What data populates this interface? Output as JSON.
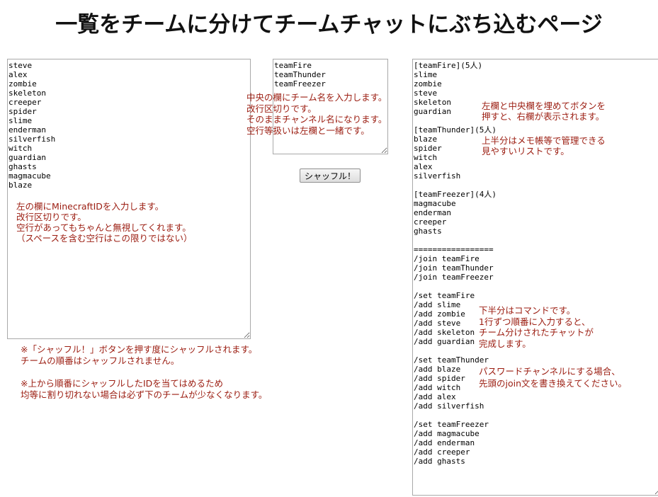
{
  "page": {
    "title": "一覧をチームに分けてチームチャットにぶち込むページ"
  },
  "left_textarea": {
    "value": "steve\nalex\nzombie\nskeleton\ncreeper\nspider\nslime\nenderman\nsilverfish\nwitch\nguardian\nghasts\nmagmacube\nblaze"
  },
  "middle_textarea": {
    "value": "teamFire\nteamThunder\nteamFreezer"
  },
  "right_textarea": {
    "value": "[teamFire](5人)\nslime\nzombie\nsteve\nskeleton\nguardian\n\n[teamThunder](5人)\nblaze\nspider\nwitch\nalex\nsilverfish\n\n[teamFreezer](4人)\nmagmacube\nenderman\ncreeper\nghasts\n\n=================\n/join teamFire\n/join teamThunder\n/join teamFreezer\n\n/set teamFire\n/add slime\n/add zombie\n/add steve\n/add skeleton\n/add guardian\n\n/set teamThunder\n/add blaze\n/add spider\n/add witch\n/add alex\n/add silverfish\n\n/set teamFreezer\n/add magmacube\n/add enderman\n/add creeper\n/add ghasts"
  },
  "shuffle_button": {
    "label": "シャッフル！"
  },
  "notes": {
    "left": "左の欄にMinecraftIDを入力します。\n改行区切りです。\n空行があってもちゃんと無視してくれます。\n（スペースを含む空行はこの限りではない）",
    "middle": "中央の欄にチーム名を入力します。\n改行区切りです。\nそのままチャンネル名になります。\n空行等扱いは左欄と一緒です。",
    "right_top_1": "左欄と中央欄を埋めてボタンを\n押すと、右欄が表示されます。",
    "right_top_2": "上半分はメモ帳等で管理できる\n見やすいリストです。",
    "right_commands": "下半分はコマンドです。\n1行ずつ順番に入力すると、\nチーム分けされたチャットが\n完成します。",
    "right_password": "パスワードチャンネルにする場合、\n先頭のjoin文を書き換えてください。",
    "bottom": "※「シャッフル！」ボタンを押す度にシャッフルされます。\nチームの順番はシャッフルされません。\n\n※上から順番にシャッフルしたIDを当てはめるため\n均等に割り切れない場合は必ず下のチームが少なくなります。"
  },
  "colors": {
    "note_text": "#9b1c10",
    "border": "#a9a9a9"
  }
}
